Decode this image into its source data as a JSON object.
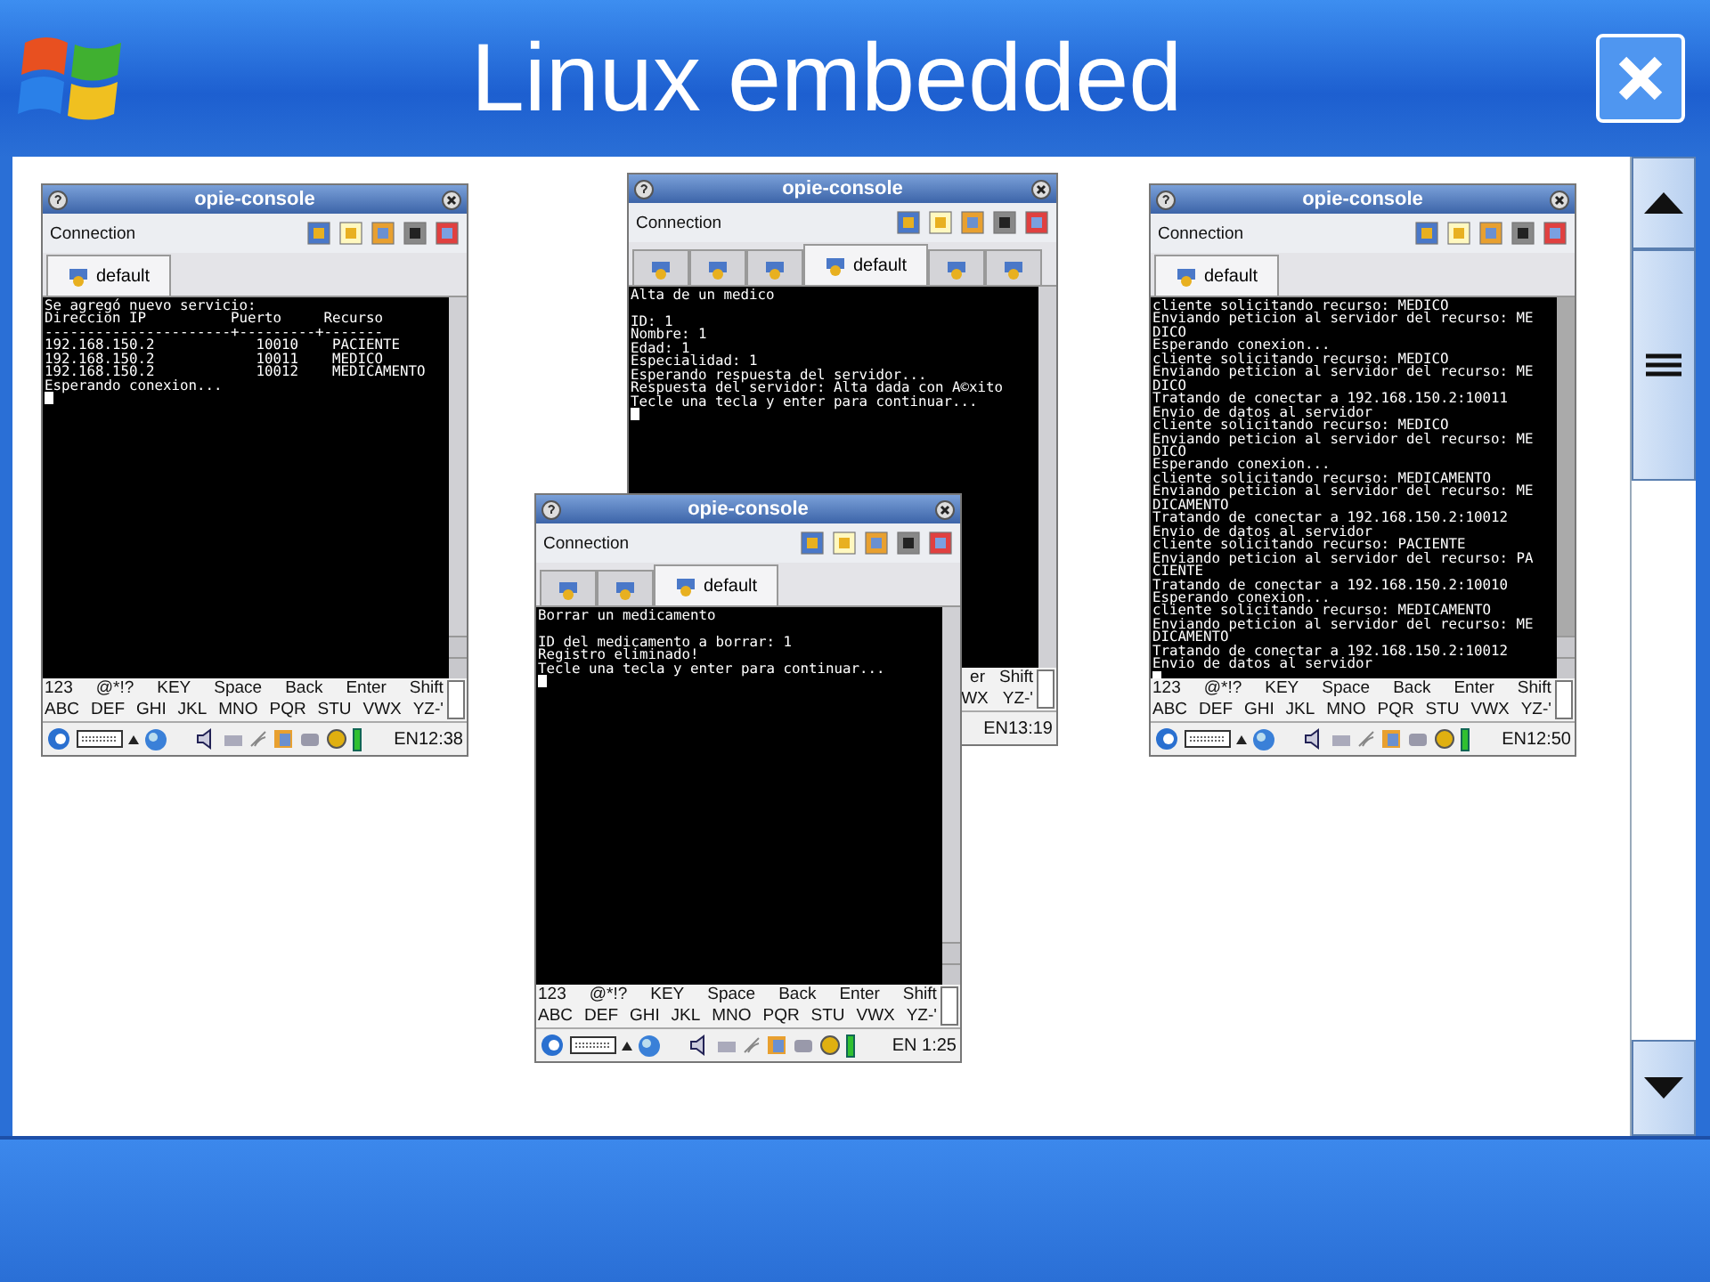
{
  "window": {
    "title": "Linux embedded"
  },
  "consoles": [
    {
      "title": "opie-console",
      "menu": "Connection",
      "tabs": [
        {
          "label": "default",
          "selected": true
        }
      ],
      "output": "Se agregó nuevo servicio:\nDireccion IP          Puerto     Recurso\n----------------------+---------+-------\n192.168.150.2            10010    PACIENTE\n192.168.150.2            10011    MEDICO\n192.168.150.2            10012    MEDICAMENTO\nEsperando conexion...",
      "keyboard": [
        [
          "123",
          "@*!?",
          "KEY",
          "Space",
          "Back",
          "Enter",
          "Shift"
        ],
        [
          "ABC",
          "DEF",
          "GHI",
          "JKL",
          "MNO",
          "PQR",
          "STU",
          "VWX",
          "YZ-'"
        ]
      ],
      "clock": "EN12:38"
    },
    {
      "title": "opie-console",
      "menu": "Connection",
      "tabs": [
        {
          "selected": false
        },
        {
          "selected": false
        },
        {
          "selected": false
        },
        {
          "label": "default",
          "selected": true
        },
        {
          "selected": false
        },
        {
          "selected": false
        }
      ],
      "output": "Alta de un medico\n\nID: 1\nNombre: 1\nEdad: 1\nEspecialidad: 1\nEsperando respuesta del servidor...\nRespuesta del servidor: Alta dada con A©xito\nTecle una tecla y enter para continuar...",
      "keyboard": [
        [
          "er",
          "Shift"
        ],
        [
          "WX",
          "YZ-'"
        ]
      ],
      "clock": "EN13:19"
    },
    {
      "title": "opie-console",
      "menu": "Connection",
      "tabs": [
        {
          "selected": false
        },
        {
          "selected": false
        },
        {
          "label": "default",
          "selected": true
        }
      ],
      "output": "Borrar un medicamento\n\nID del medicamento a borrar: 1\nRegistro eliminado!\nTecle una tecla y enter para continuar...",
      "keyboard": [
        [
          "123",
          "@*!?",
          "KEY",
          "Space",
          "Back",
          "Enter",
          "Shift"
        ],
        [
          "ABC",
          "DEF",
          "GHI",
          "JKL",
          "MNO",
          "PQR",
          "STU",
          "VWX",
          "YZ-'"
        ]
      ],
      "clock": "EN 1:25"
    },
    {
      "title": "opie-console",
      "menu": "Connection",
      "tabs": [
        {
          "label": "default",
          "selected": true
        }
      ],
      "output": "cliente solicitando recurso: MEDICO\nEnviando peticion al servidor del recurso: ME\nDICO\nEsperando conexion...\ncliente solicitando recurso: MEDICO\nEnviando peticion al servidor del recurso: ME\nDICO\nTratando de conectar a 192.168.150.2:10011\nEnvio de datos al servidor\ncliente solicitando recurso: MEDICO\nEnviando peticion al servidor del recurso: ME\nDICO\nEsperando conexion...\ncliente solicitando recurso: MEDICAMENTO\nEnviando peticion al servidor del recurso: ME\nDICAMENTO\nTratando de conectar a 192.168.150.2:10012\nEnvio de datos al servidor\ncliente solicitando recurso: PACIENTE\nEnviando peticion al servidor del recurso: PA\nCIENTE\nTratando de conectar a 192.168.150.2:10010\nEsperando conexion...\ncliente solicitando recurso: MEDICAMENTO\nEnviando peticion al servidor del recurso: ME\nDICAMENTO\nTratando de conectar a 192.168.150.2:10012\nEnvio de datos al servidor",
      "keyboard": [
        [
          "123",
          "@*!?",
          "KEY",
          "Space",
          "Back",
          "Enter",
          "Shift"
        ],
        [
          "ABC",
          "DEF",
          "GHI",
          "JKL",
          "MNO",
          "PQR",
          "STU",
          "VWX",
          "YZ-'"
        ]
      ],
      "clock": "EN12:50"
    }
  ]
}
